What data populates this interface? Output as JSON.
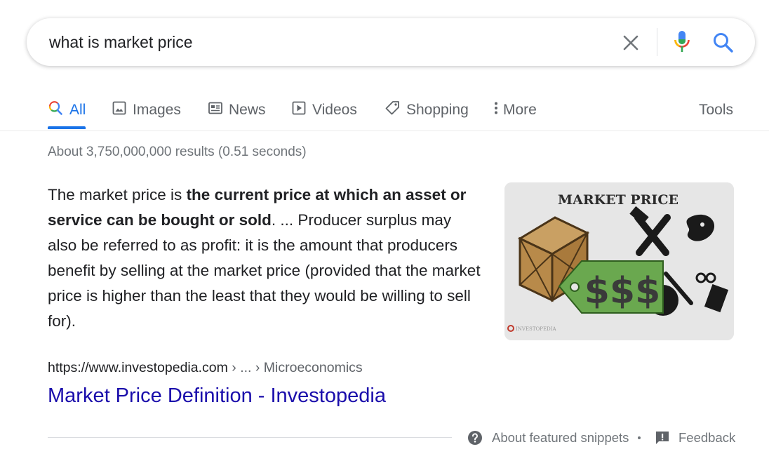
{
  "search": {
    "query": "what is market price"
  },
  "tabs": [
    {
      "label": "All",
      "icon": "search-icon",
      "active": true
    },
    {
      "label": "Images",
      "icon": "image-icon"
    },
    {
      "label": "News",
      "icon": "news-icon"
    },
    {
      "label": "Videos",
      "icon": "play-icon"
    },
    {
      "label": "Shopping",
      "icon": "tag-icon"
    },
    {
      "label": "More",
      "icon": "more-vert-icon"
    }
  ],
  "tools_label": "Tools",
  "result_stats": "About 3,750,000,000 results (0.51 seconds)",
  "snippet": {
    "prefix": "The market price is ",
    "bold": "the current price at which an asset or service can be bought or sold",
    "suffix": ". ... Producer surplus may also be referred to as profit: it is the amount that producers benefit by selling at the market price (provided that the market price is higher than the least that they would be willing to sell for)."
  },
  "thumbnail": {
    "title": "MARKET PRICE",
    "tag_text": "$$$",
    "logo": "INVESTOPEDIA"
  },
  "cite": {
    "url": "https://www.investopedia.com",
    "path": " › ... › Microeconomics"
  },
  "result_title": "Market Price Definition - Investopedia",
  "footer": {
    "about_label": "About featured snippets",
    "feedback_label": "Feedback"
  },
  "colors": {
    "link": "#1a0dab",
    "accent": "#1a73e8",
    "muted": "#70757a"
  }
}
